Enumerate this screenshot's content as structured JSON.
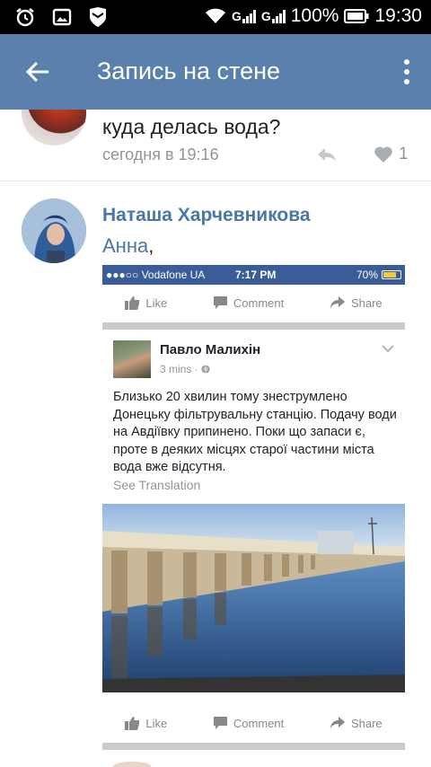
{
  "status_bar": {
    "network_labels": [
      "G",
      "G"
    ],
    "battery": "100%",
    "time": "19:30"
  },
  "app_bar": {
    "title": "Запись на стене"
  },
  "comments": [
    {
      "text": "куда делась вода?",
      "time": "сегодня в 19:16",
      "likes": "1"
    },
    {
      "author": "Наташа Харчевникова",
      "mention": "Анна",
      "mention_suffix": ","
    }
  ],
  "screenshot": {
    "carrier": "●●●○○ Vodafone UA",
    "time": "7:17 PM",
    "battery": "70%",
    "actions": [
      "Like",
      "Comment",
      "Share"
    ],
    "post": {
      "author": "Павло Малихін",
      "time": "3 mins ·",
      "text": "Близько 20 хвилин тому знеструмлено Донецьку фільтрувальну станцію. Подачу води на Авдіївку припинено. Поки що запаси є, проте в деяких місцях старої частини міста вода вже відсутня.",
      "translate": "See Translation"
    }
  },
  "colors": {
    "app_bar": "#5a80ad",
    "link": "#4a76a8",
    "meta_text": "#8f959c",
    "ios_bar": "#3a5d9a"
  },
  "icons": [
    "alarm-icon",
    "gallery-icon",
    "shield-icon",
    "wifi-icon",
    "battery-icon",
    "back-arrow-icon",
    "more-vert-icon",
    "reply-icon",
    "heart-icon",
    "like-icon",
    "comment-icon",
    "share-icon",
    "globe-icon",
    "chevron-down-icon"
  ]
}
